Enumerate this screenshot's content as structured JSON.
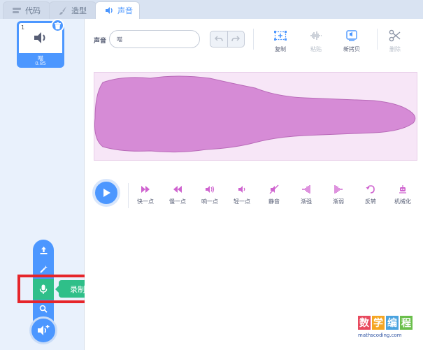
{
  "tabs": [
    {
      "label": "代码",
      "icon": "code-icon"
    },
    {
      "label": "造型",
      "icon": "brush-icon"
    },
    {
      "label": "声音",
      "icon": "speaker-icon"
    }
  ],
  "sound_list": [
    {
      "number": "1",
      "name": "喵",
      "duration": "0.85"
    }
  ],
  "add_menu": {
    "items": [
      "upload-icon",
      "surprise-icon",
      "microphone-icon",
      "search-icon"
    ],
    "tooltip": "录制"
  },
  "editor": {
    "name_label": "声音",
    "name_value": "喵",
    "tools": {
      "copy": "复制",
      "paste": "粘贴",
      "copy_new": "新拷贝",
      "delete": "删除"
    }
  },
  "effects": [
    "快一点",
    "慢一点",
    "响一点",
    "轻一点",
    "静音",
    "渐强",
    "渐弱",
    "反转",
    "机械化"
  ],
  "logo": {
    "chars": [
      "数",
      "学",
      "编",
      "程"
    ],
    "site": "mathscoding.com"
  },
  "colors": {
    "accent": "#4c97ff",
    "record_green": "#2fbf89",
    "wave_fill": "#d68bd6",
    "highlight_red": "#e6252a"
  }
}
